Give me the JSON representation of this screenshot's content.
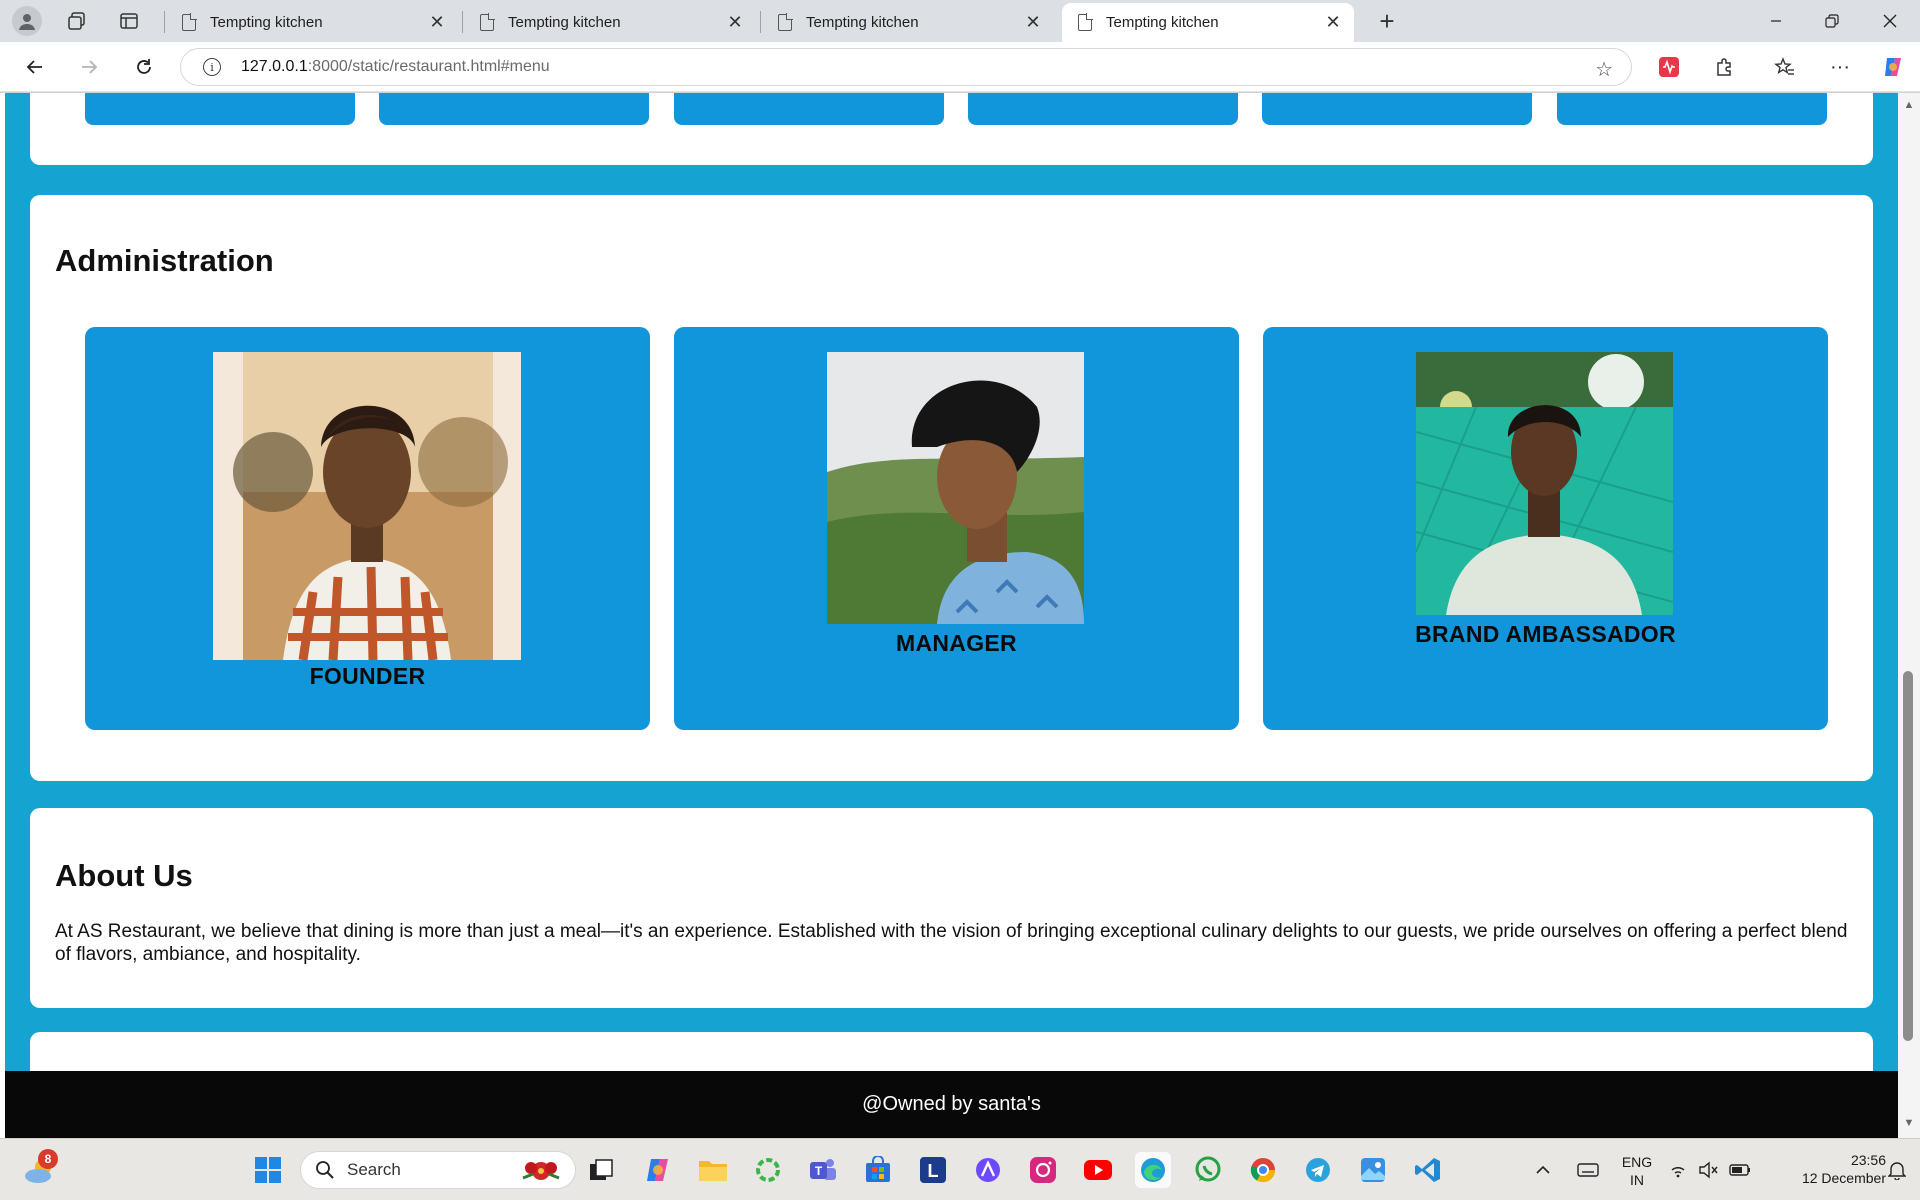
{
  "browser": {
    "tabs": [
      {
        "title": "Tempting kitchen",
        "active": false
      },
      {
        "title": "Tempting kitchen",
        "active": false
      },
      {
        "title": "Tempting kitchen",
        "active": false
      },
      {
        "title": "Tempting kitchen",
        "active": true
      }
    ],
    "url_host": "127.0.0.1",
    "url_rest": ":8000/static/restaurant.html#menu"
  },
  "page": {
    "admin_title": "Administration",
    "team": [
      {
        "role": "FOUNDER"
      },
      {
        "role": "MANAGER"
      },
      {
        "role": "BRAND AMBASSADOR"
      }
    ],
    "about_title": "About Us",
    "about_text": "At AS Restaurant, we believe that dining is more than just a meal—it's an experience. Established with the vision of bringing exceptional culinary delights to our guests, we pride ourselves on offering a perfect blend of flavors, ambiance, and hospitality.",
    "footer_text": "@Owned by santa's",
    "colors": {
      "page_bg": "#15a4d1",
      "tile": "#1296db",
      "footer": "#080808"
    }
  },
  "taskbar": {
    "search_placeholder": "Search",
    "weather_badge": "8",
    "lang_top": "ENG",
    "lang_bottom": "IN",
    "time": "23:56",
    "date": "12 December"
  }
}
